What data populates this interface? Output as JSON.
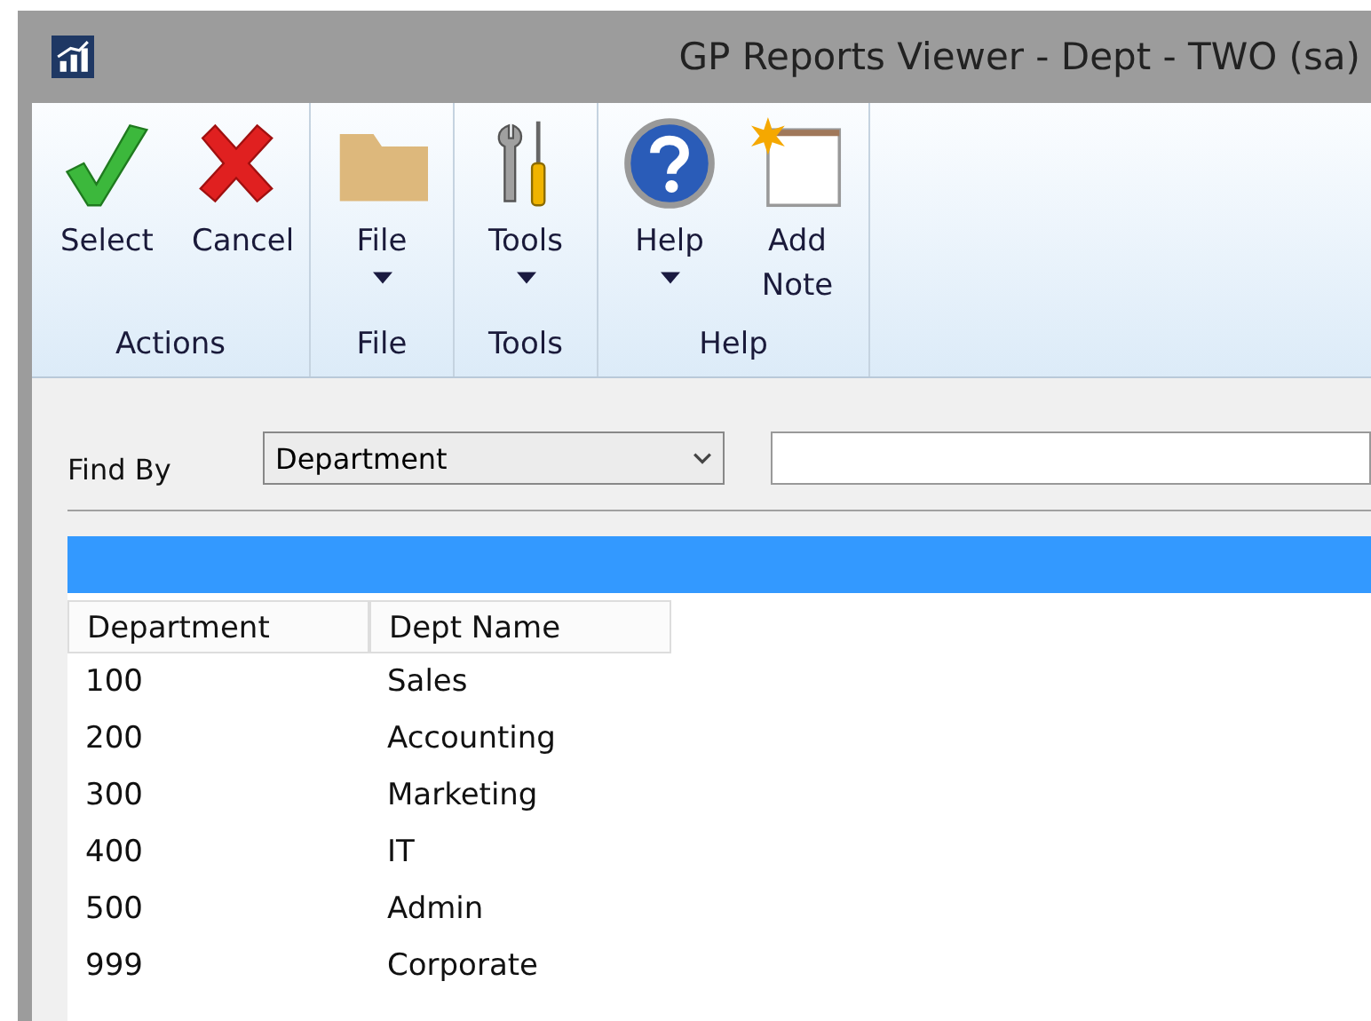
{
  "window": {
    "title": "GP Reports Viewer - Dept  -  TWO (sa)"
  },
  "ribbon": [
    {
      "label": "Actions",
      "buttons": [
        {
          "label": "Select",
          "kind": "check",
          "dropdown": false
        },
        {
          "label": "Cancel",
          "kind": "cross",
          "dropdown": false
        }
      ]
    },
    {
      "label": "File",
      "buttons": [
        {
          "label": "File",
          "kind": "folder",
          "dropdown": true
        }
      ]
    },
    {
      "label": "Tools",
      "buttons": [
        {
          "label": "Tools",
          "kind": "tools",
          "dropdown": true
        }
      ]
    },
    {
      "label": "Help",
      "buttons": [
        {
          "label": "Help",
          "kind": "help",
          "dropdown": true
        },
        {
          "label": "Add Note",
          "kind": "note",
          "dropdown": false
        }
      ]
    }
  ],
  "find": {
    "label": "Find By",
    "value": "Department"
  },
  "table": {
    "columns": [
      "Department",
      "Dept Name"
    ],
    "rows": [
      [
        "100",
        "Sales"
      ],
      [
        "200",
        "Accounting"
      ],
      [
        "300",
        "Marketing"
      ],
      [
        "400",
        "IT"
      ],
      [
        "500",
        "Admin"
      ],
      [
        "999",
        "Corporate"
      ]
    ]
  }
}
